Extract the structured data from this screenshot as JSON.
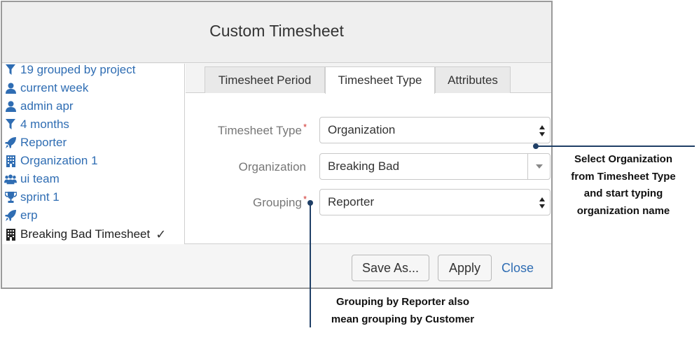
{
  "dialog": {
    "title": "Custom Timesheet"
  },
  "sidebar": {
    "items": [
      {
        "label": "19 grouped by project",
        "icon": "filter-icon"
      },
      {
        "label": "current week",
        "icon": "user-icon"
      },
      {
        "label": "admin apr",
        "icon": "user-icon"
      },
      {
        "label": "4 months",
        "icon": "filter-icon"
      },
      {
        "label": "Reporter",
        "icon": "rocket-icon"
      },
      {
        "label": "Organization 1",
        "icon": "building-icon"
      },
      {
        "label": "ui team",
        "icon": "users-icon"
      },
      {
        "label": "sprint 1",
        "icon": "trophy-icon"
      },
      {
        "label": "erp",
        "icon": "rocket-icon"
      },
      {
        "label": "Breaking Bad Timesheet",
        "icon": "building-icon",
        "active": true
      }
    ]
  },
  "tabs": [
    {
      "label": "Timesheet Period"
    },
    {
      "label": "Timesheet Type",
      "active": true
    },
    {
      "label": "Attributes"
    }
  ],
  "form": {
    "type_label": "Timesheet Type",
    "type_value": "Organization",
    "org_label": "Organization",
    "org_value": "Breaking Bad",
    "grouping_label": "Grouping",
    "grouping_value": "Reporter",
    "required_mark": "*"
  },
  "footer": {
    "save_as": "Save As...",
    "apply": "Apply",
    "close": "Close"
  },
  "callouts": {
    "org_lines": [
      "Select Organization",
      "from Timesheet Type",
      "and start typing",
      "organization name"
    ],
    "grouping_lines": [
      "Grouping by Reporter also",
      "mean grouping by Customer"
    ]
  },
  "colors": {
    "link": "#2f6db3",
    "required": "#d0312d",
    "callout_line": "#1f3f66"
  }
}
